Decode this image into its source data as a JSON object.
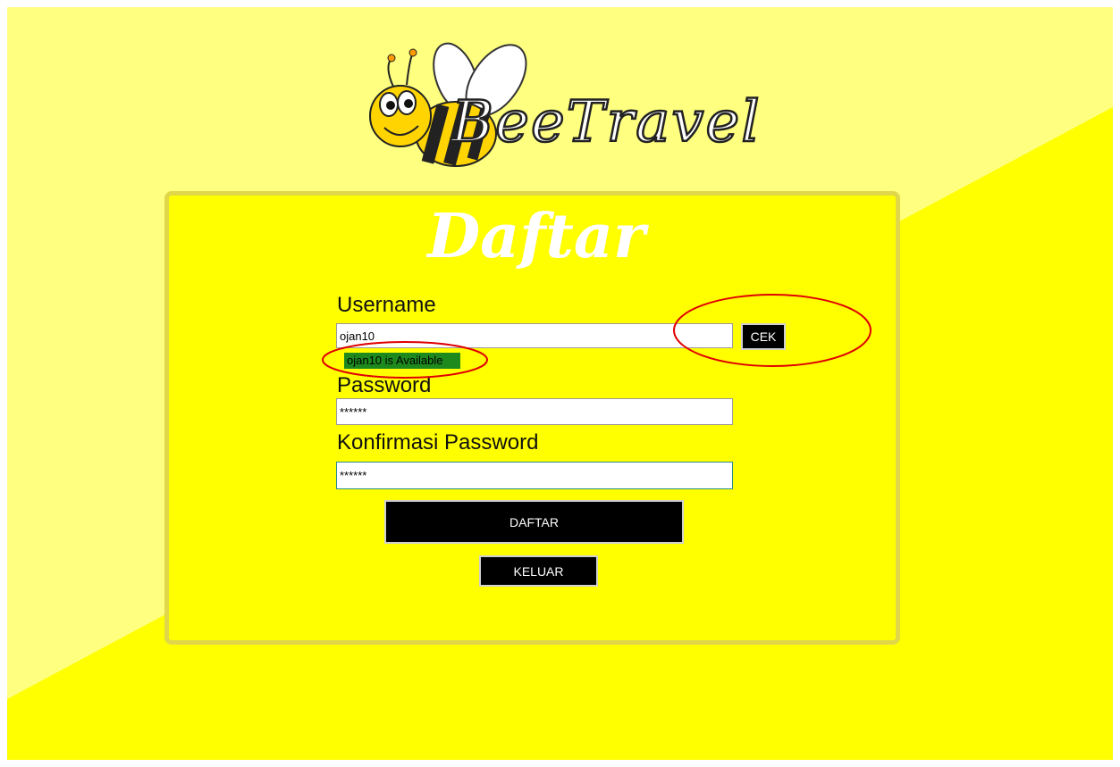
{
  "brand": {
    "logo_text": "BeeTravel"
  },
  "form": {
    "title": "Daftar",
    "username": {
      "label": "Username",
      "value": "ojan10"
    },
    "check_button": "CEK",
    "availability": "ojan10 is Available",
    "password": {
      "label": "Password",
      "value": "******"
    },
    "confirm_password": {
      "label": "Konfirmasi Password",
      "value": "******"
    },
    "submit_button": "DAFTAR",
    "exit_button": "KELUAR"
  },
  "colors": {
    "background_light": "#ffff80",
    "background_main": "#ffff00",
    "available_badge": "#1e8a1e",
    "annotation": "#e00000"
  }
}
